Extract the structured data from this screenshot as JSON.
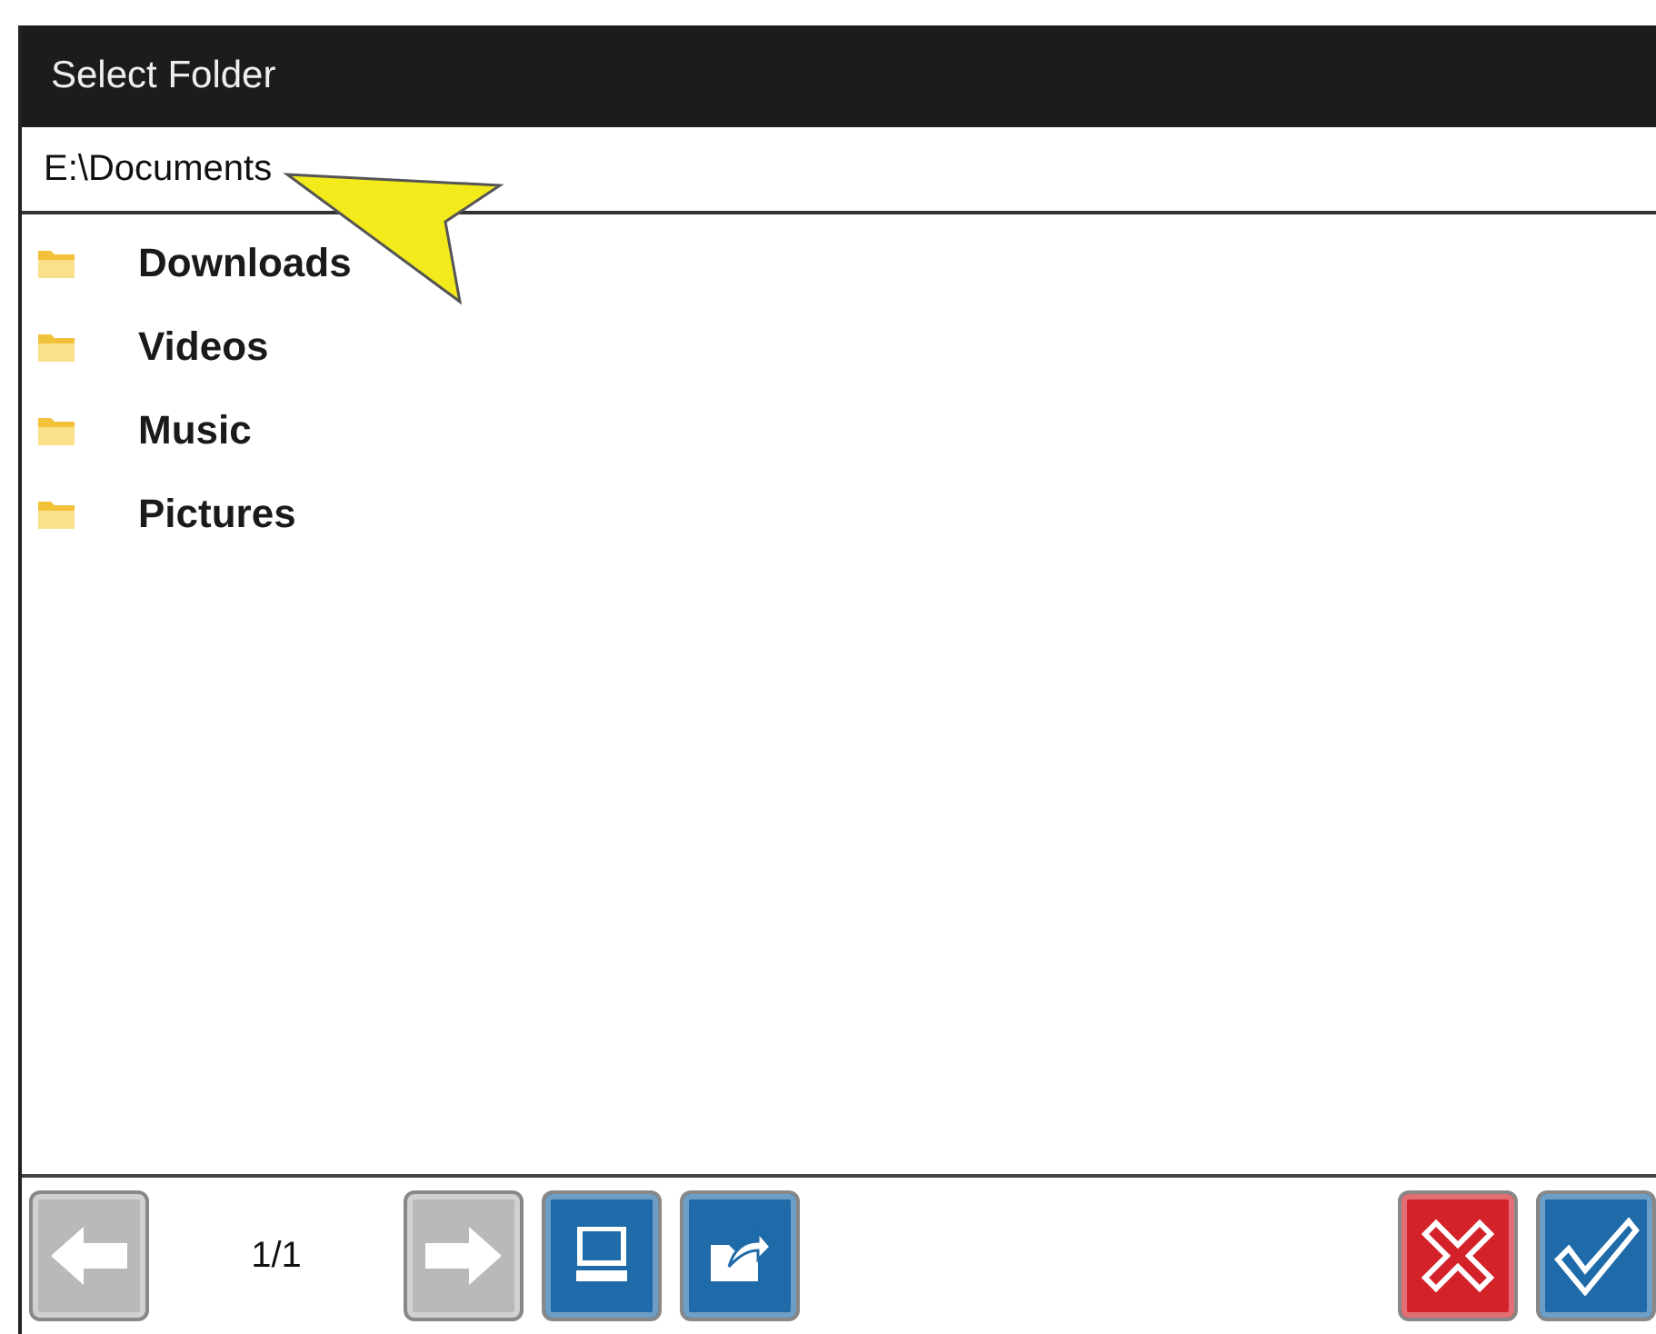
{
  "window": {
    "title": "Select Folder"
  },
  "path": {
    "value": "E:\\Documents"
  },
  "folders": [
    {
      "name": "Downloads"
    },
    {
      "name": "Videos"
    },
    {
      "name": "Music"
    },
    {
      "name": "Pictures"
    }
  ],
  "toolbar": {
    "page": "1/1",
    "buttons": [
      {
        "kind": "prev"
      },
      {
        "kind": "next"
      },
      {
        "kind": "computer"
      },
      {
        "kind": "folder-up"
      }
    ],
    "actions": [
      {
        "kind": "cancel"
      },
      {
        "kind": "confirm"
      }
    ]
  },
  "callout": {
    "shown": true
  }
}
